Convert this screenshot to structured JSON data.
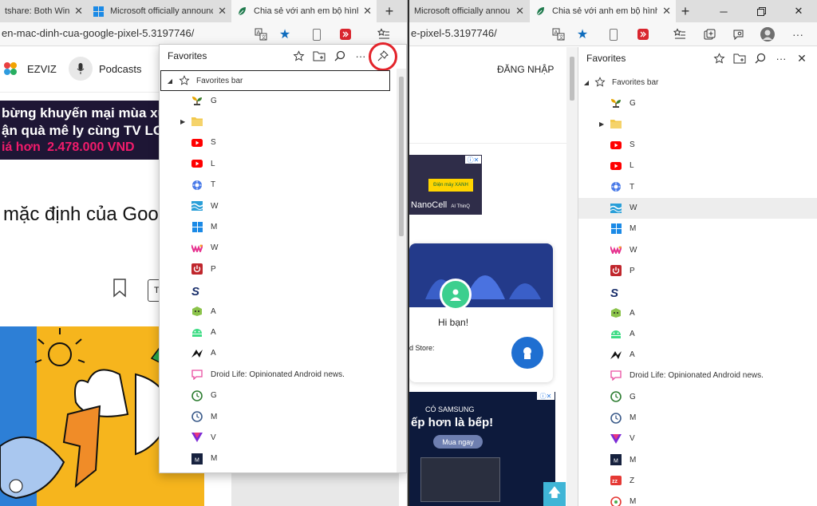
{
  "left_window": {
    "tabs": [
      {
        "label": "tshare: Both Windo"
      },
      {
        "label": "Microsoft officially announce"
      },
      {
        "label": "Chia sẻ với anh em bộ hình n"
      }
    ],
    "url": "en-mac-dinh-cua-google-pixel-5.3197746/",
    "page": {
      "nav_items": [
        "EZVIZ",
        "Podcasts"
      ],
      "promo_lines": [
        "bừng khuyến mại mùa xuân",
        "ận quà mê ly cùng TV LG"
      ],
      "promo_price_prefix": "iá hơn",
      "promo_price": "2.478.000 VND",
      "headline": "mặc định của Goo",
      "small_box": "T"
    },
    "favorites_popup": {
      "title": "Favorites",
      "root_label": "Favorites bar",
      "items": [
        {
          "label": "G",
          "icon": "sprout-icon"
        },
        {
          "label": "",
          "icon": "folder-icon"
        },
        {
          "label": "S",
          "icon": "youtube-icon"
        },
        {
          "label": "L",
          "icon": "youtube-icon"
        },
        {
          "label": "T",
          "icon": "gear-icon"
        },
        {
          "label": "W",
          "icon": "wave-icon"
        },
        {
          "label": "M",
          "icon": "windows-icon"
        },
        {
          "label": "W",
          "icon": "w-logo-icon"
        },
        {
          "label": "P",
          "icon": "power-icon"
        },
        {
          "label": "",
          "icon": "s-logo-icon"
        },
        {
          "label": "A",
          "icon": "android-cube-icon"
        },
        {
          "label": "A",
          "icon": "android-head-icon"
        },
        {
          "label": "A",
          "icon": "arrow-logo-icon"
        },
        {
          "label": "Droid Life: Opinionated Android news.",
          "icon": "speech-bubble-icon"
        },
        {
          "label": "G",
          "icon": "clock-green-icon"
        },
        {
          "label": "M",
          "icon": "clock-blue-icon"
        },
        {
          "label": "V",
          "icon": "v-logo-icon"
        },
        {
          "label": "M",
          "icon": "m-dark-icon"
        }
      ]
    }
  },
  "right_window": {
    "tabs": [
      {
        "label": "Microsoft officially announce"
      },
      {
        "label": "Chia sẻ với anh em bộ hình n"
      }
    ],
    "url": "e-pixel-5.3197746/",
    "page": {
      "login": "ĐĂNG NHẬP",
      "ad1_brand": "NanoCell",
      "ad1_sub": "AI ThinQ",
      "ad1_logo": "Điện máy XANH",
      "card_greeting": "Hi bạn!",
      "card_store": "d Store:",
      "ad2_line1": "CÓ SAMSUNG",
      "ad2_line2": "ếp hơn là bếp!",
      "ad2_button": "Mua ngay"
    },
    "favorites_sidebar": {
      "title": "Favorites",
      "root_label": "Favorites bar",
      "items": [
        {
          "label": "G",
          "icon": "sprout-icon"
        },
        {
          "label": "",
          "icon": "folder-icon"
        },
        {
          "label": "S",
          "icon": "youtube-icon"
        },
        {
          "label": "L",
          "icon": "youtube-icon"
        },
        {
          "label": "T",
          "icon": "gear-icon"
        },
        {
          "label": "W",
          "icon": "wave-icon"
        },
        {
          "label": "M",
          "icon": "windows-icon"
        },
        {
          "label": "W",
          "icon": "w-logo-icon"
        },
        {
          "label": "P",
          "icon": "power-icon"
        },
        {
          "label": "",
          "icon": "s-logo-icon"
        },
        {
          "label": "A",
          "icon": "android-cube-icon"
        },
        {
          "label": "A",
          "icon": "android-head-icon"
        },
        {
          "label": "A",
          "icon": "arrow-logo-icon"
        },
        {
          "label": "Droid Life: Opinionated Android news.",
          "icon": "speech-bubble-icon"
        },
        {
          "label": "G",
          "icon": "clock-green-icon"
        },
        {
          "label": "M",
          "icon": "clock-blue-icon"
        },
        {
          "label": "V",
          "icon": "v-logo-icon"
        },
        {
          "label": "M",
          "icon": "m-dark-icon"
        },
        {
          "label": "Z",
          "icon": "z-red-icon"
        },
        {
          "label": "M",
          "icon": "m-round-icon"
        }
      ]
    }
  },
  "colors": {
    "accent_blue": "#0f6cbd",
    "highlight_red": "#e3242b",
    "promo_pink": "#f21b6b",
    "promo_dark": "#1e1635"
  }
}
